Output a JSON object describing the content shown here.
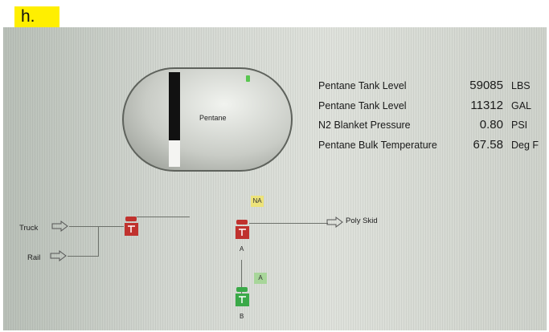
{
  "label_tag": "h.",
  "tank": {
    "label": "Pentane",
    "level_fraction": 0.28
  },
  "readouts": [
    {
      "name": "Pentane Tank Level",
      "value": "59085",
      "unit": "LBS"
    },
    {
      "name": "Pentane Tank Level",
      "value": "11312",
      "unit": "GAL"
    },
    {
      "name": "N2 Blanket Pressure",
      "value": "0.80",
      "unit": "PSI"
    },
    {
      "name": "Pentane Bulk Temperature",
      "value": "67.58",
      "unit": "Deg F"
    }
  ],
  "sources": {
    "truck": "Truck",
    "rail": "Rail"
  },
  "destination": "Poly Skid",
  "valves": {
    "inlet": {
      "state_color": "#c0322e"
    },
    "pump_a": {
      "label": "A",
      "status": "NA",
      "state_color": "#c0322e"
    },
    "pump_b": {
      "label": "B",
      "status": "A",
      "state_color": "#3aa948"
    }
  },
  "colors": {
    "stopped": "#c0322e",
    "running": "#3aa948",
    "status_na": "#ede37a",
    "status_a": "#a8d69a"
  },
  "icons": [
    "flow-arrow-icon",
    "valve-icon",
    "pump-icon"
  ]
}
